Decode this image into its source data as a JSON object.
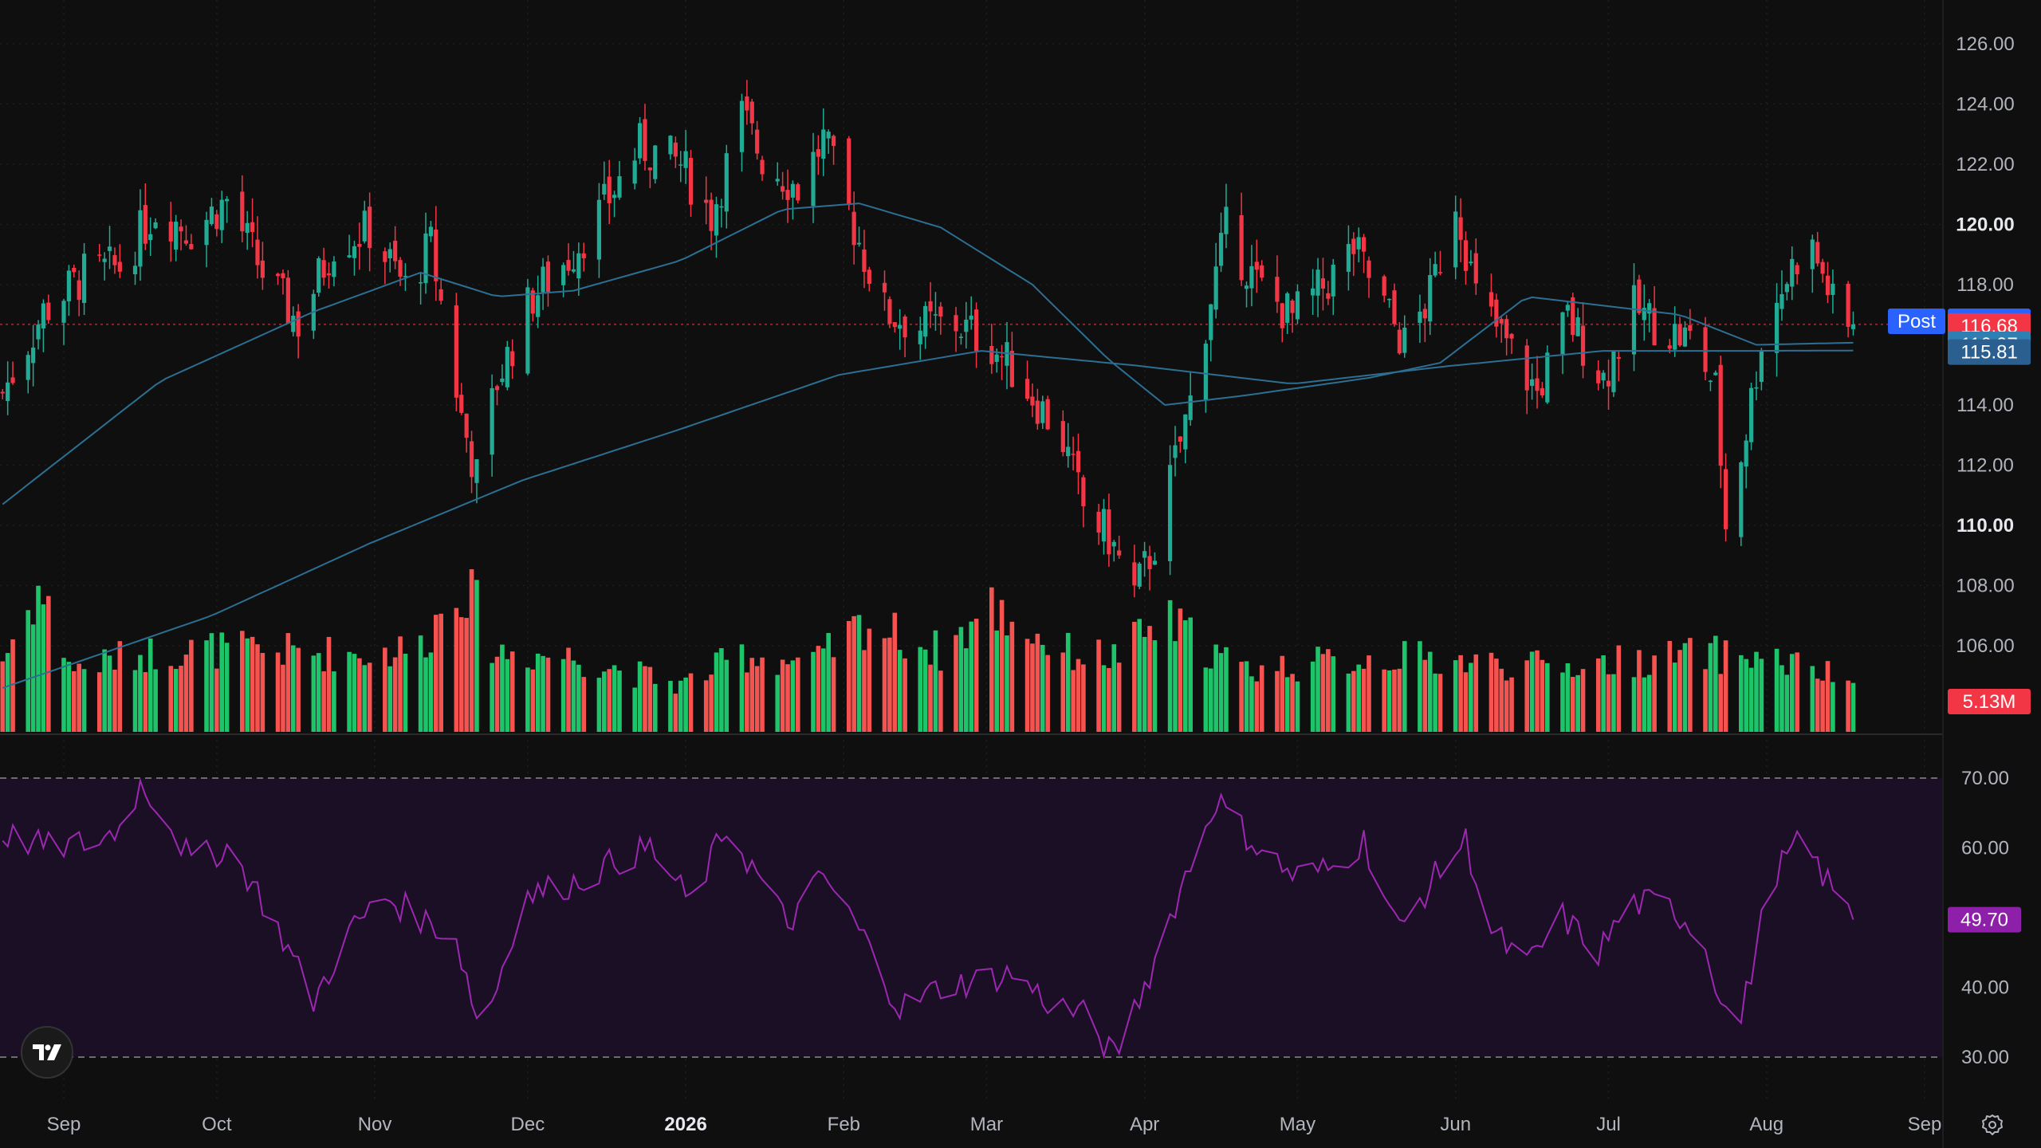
{
  "chart_data": [
    {
      "type": "candlestick",
      "price_axis": {
        "ticks": [
          "126.00",
          "124.00",
          "122.00",
          "120.00",
          "118.00",
          "114.00",
          "112.00",
          "110.00",
          "108.00",
          "106.00"
        ],
        "bold_ticks": [
          "120.00",
          "110.00"
        ],
        "range": [
          104.5,
          126.5
        ]
      },
      "time_axis": {
        "ticks": [
          {
            "label": "Sep",
            "date": "2025-09-01"
          },
          {
            "label": "Oct",
            "date": "2025-10-01"
          },
          {
            "label": "Nov",
            "date": "2025-11-01"
          },
          {
            "label": "Dec",
            "date": "2025-12-01"
          },
          {
            "label": "2026",
            "date": "2026-01-01",
            "bold": true
          },
          {
            "label": "Feb",
            "date": "2026-02-01"
          },
          {
            "label": "Mar",
            "date": "2026-03-01"
          },
          {
            "label": "Apr",
            "date": "2026-04-01"
          },
          {
            "label": "May",
            "date": "2026-05-01"
          },
          {
            "label": "Jun",
            "date": "2026-06-01"
          },
          {
            "label": "Jul",
            "date": "2026-07-01"
          },
          {
            "label": "Aug",
            "date": "2026-08-01"
          },
          {
            "label": "Sep",
            "date": "2026-09-01"
          }
        ]
      },
      "price_path": [
        [
          "2025-08-20",
          114.4
        ],
        [
          "2025-08-28",
          117.1
        ],
        [
          "2025-09-05",
          118.3
        ],
        [
          "2025-09-12",
          118.6
        ],
        [
          "2025-09-19",
          120.5
        ],
        [
          "2025-09-26",
          119.8
        ],
        [
          "2025-10-03",
          120.8
        ],
        [
          "2025-10-10",
          118.4
        ],
        [
          "2025-10-17",
          116.7
        ],
        [
          "2025-10-24",
          119.4
        ],
        [
          "2025-10-31",
          119.8
        ],
        [
          "2025-11-07",
          117.9
        ],
        [
          "2025-11-12",
          119.3
        ],
        [
          "2025-11-18",
          113.6
        ],
        [
          "2025-11-21",
          111.6
        ],
        [
          "2025-11-25",
          114.8
        ],
        [
          "2025-12-02",
          117.6
        ],
        [
          "2025-12-09",
          118.9
        ],
        [
          "2025-12-16",
          120.6
        ],
        [
          "2025-12-23",
          122.6
        ],
        [
          "2025-12-31",
          122.0
        ],
        [
          "2026-01-06",
          120.3
        ],
        [
          "2026-01-12",
          123.6
        ],
        [
          "2026-01-16",
          122.2
        ],
        [
          "2026-01-23",
          121.2
        ],
        [
          "2026-01-28",
          122.8
        ],
        [
          "2026-02-03",
          119.9
        ],
        [
          "2026-02-09",
          117.1
        ],
        [
          "2026-02-16",
          116.6
        ],
        [
          "2026-02-23",
          116.7
        ],
        [
          "2026-03-02",
          116.0
        ],
        [
          "2026-03-06",
          115.2
        ],
        [
          "2026-03-11",
          114.1
        ],
        [
          "2026-03-16",
          112.8
        ],
        [
          "2026-03-20",
          110.6
        ],
        [
          "2026-03-25",
          109.6
        ],
        [
          "2026-03-30",
          107.7
        ],
        [
          "2026-04-03",
          109.4
        ],
        [
          "2026-04-07",
          112.1
        ],
        [
          "2026-04-10",
          114.1
        ],
        [
          "2026-04-14",
          117.6
        ],
        [
          "2026-04-17",
          119.8
        ],
        [
          "2026-04-23",
          118.0
        ],
        [
          "2026-04-30",
          116.9
        ],
        [
          "2026-05-07",
          118.1
        ],
        [
          "2026-05-12",
          119.2
        ],
        [
          "2026-05-18",
          117.3
        ],
        [
          "2026-05-22",
          116.0
        ],
        [
          "2026-05-27",
          117.6
        ],
        [
          "2026-06-01",
          120.9
        ],
        [
          "2026-06-05",
          117.6
        ],
        [
          "2026-06-11",
          116.0
        ],
        [
          "2026-06-17",
          114.4
        ],
        [
          "2026-06-23",
          116.9
        ],
        [
          "2026-06-30",
          114.9
        ],
        [
          "2026-07-06",
          117.2
        ],
        [
          "2026-07-12",
          116.5
        ],
        [
          "2026-07-18",
          116.1
        ],
        [
          "2026-07-22",
          114.5
        ],
        [
          "2026-07-24",
          110.0
        ],
        [
          "2026-07-28",
          113.2
        ],
        [
          "2026-07-31",
          116.2
        ],
        [
          "2026-08-04",
          117.9
        ],
        [
          "2026-08-09",
          119.6
        ],
        [
          "2026-08-13",
          117.9
        ],
        [
          "2026-08-16",
          116.2
        ],
        [
          "2026-08-18",
          116.68
        ]
      ],
      "ma_short": [
        [
          "2025-08-20",
          110.7
        ],
        [
          "2025-09-20",
          114.8
        ],
        [
          "2025-10-20",
          117.1
        ],
        [
          "2025-11-10",
          118.4
        ],
        [
          "2025-11-25",
          117.6
        ],
        [
          "2025-12-10",
          117.8
        ],
        [
          "2025-12-31",
          118.8
        ],
        [
          "2026-01-20",
          120.5
        ],
        [
          "2026-02-04",
          120.7
        ],
        [
          "2026-02-20",
          119.9
        ],
        [
          "2026-03-10",
          118.0
        ],
        [
          "2026-03-25",
          115.5
        ],
        [
          "2026-04-05",
          114.0
        ],
        [
          "2026-04-20",
          114.3
        ],
        [
          "2026-05-15",
          114.9
        ],
        [
          "2026-05-29",
          115.4
        ],
        [
          "2026-06-15",
          117.6
        ],
        [
          "2026-06-30",
          117.3
        ],
        [
          "2026-07-15",
          117.0
        ],
        [
          "2026-07-30",
          116.0
        ],
        [
          "2026-08-18",
          116.07
        ]
      ],
      "ma_long": [
        [
          "2025-08-20",
          104.6
        ],
        [
          "2025-09-30",
          107.0
        ],
        [
          "2025-10-31",
          109.4
        ],
        [
          "2025-11-30",
          111.5
        ],
        [
          "2025-12-31",
          113.2
        ],
        [
          "2026-01-31",
          115.0
        ],
        [
          "2026-02-28",
          115.8
        ],
        [
          "2026-03-31",
          115.3
        ],
        [
          "2026-04-30",
          114.7
        ],
        [
          "2026-05-31",
          115.3
        ],
        [
          "2026-06-30",
          115.8
        ],
        [
          "2026-07-31",
          115.8
        ],
        [
          "2026-08-18",
          115.81
        ]
      ],
      "volume_path": [
        [
          "2025-08-20",
          2.8
        ],
        [
          "2025-08-27",
          5.5
        ],
        [
          "2025-09-03",
          2.4
        ],
        [
          "2025-09-15",
          3.0
        ],
        [
          "2025-09-30",
          3.2
        ],
        [
          "2025-10-15",
          3.1
        ],
        [
          "2025-11-01",
          3.0
        ],
        [
          "2025-11-10",
          3.3
        ],
        [
          "2025-11-18",
          5.9
        ],
        [
          "2025-11-25",
          3.1
        ],
        [
          "2025-12-10",
          2.9
        ],
        [
          "2025-12-31",
          1.8
        ],
        [
          "2026-01-12",
          3.0
        ],
        [
          "2026-01-26",
          2.6
        ],
        [
          "2026-02-05",
          4.2
        ],
        [
          "2026-02-20",
          3.1
        ],
        [
          "2026-03-02",
          4.8
        ],
        [
          "2026-03-16",
          3.1
        ],
        [
          "2026-03-26",
          2.9
        ],
        [
          "2026-04-05",
          4.3
        ],
        [
          "2026-04-20",
          2.4
        ],
        [
          "2026-05-20",
          2.9
        ],
        [
          "2026-06-20",
          2.5
        ],
        [
          "2026-07-20",
          3.0
        ],
        [
          "2026-08-01",
          2.9
        ],
        [
          "2026-08-18",
          1.9
        ]
      ],
      "series": [
        {
          "name": "Post",
          "value": "116.78",
          "color": "#2962ff"
        },
        {
          "name": "",
          "value": "116.68",
          "color": "#f23645"
        },
        {
          "name": "",
          "value": "116.07",
          "color": "#2f7fb3"
        },
        {
          "name": "",
          "value": "115.81",
          "color": "#2a5f8f"
        }
      ],
      "volume_label": "5.13M",
      "colors": {
        "up": "#22ab94",
        "down": "#f23645",
        "vol_up": "#1ec46a",
        "vol_down": "#f5534f",
        "ma": "#2c6f93",
        "grid": "#1f1f1f",
        "current_line": "#f23645"
      }
    },
    {
      "type": "line",
      "indicator": "RSI",
      "y_ticks": [
        "70.00",
        "60.00",
        "50.00",
        "40.00",
        "30.00"
      ],
      "ylim": [
        27.5,
        71.5
      ],
      "bands": [
        30,
        70
      ],
      "current_value": "49.70",
      "path": [
        [
          "2025-08-20",
          62
        ],
        [
          "2025-08-29",
          60
        ],
        [
          "2025-09-08",
          61
        ],
        [
          "2025-09-12",
          63
        ],
        [
          "2025-09-16",
          69
        ],
        [
          "2025-09-20",
          66
        ],
        [
          "2025-09-26",
          58
        ],
        [
          "2025-10-03",
          60
        ],
        [
          "2025-10-08",
          55
        ],
        [
          "2025-10-14",
          47
        ],
        [
          "2025-10-20",
          38
        ],
        [
          "2025-10-27",
          48
        ],
        [
          "2025-11-03",
          53
        ],
        [
          "2025-11-10",
          50
        ],
        [
          "2025-11-17",
          47
        ],
        [
          "2025-11-22",
          33
        ],
        [
          "2025-11-30",
          53
        ],
        [
          "2025-12-10",
          55
        ],
        [
          "2025-12-18",
          58
        ],
        [
          "2025-12-25",
          60
        ],
        [
          "2026-01-02",
          52
        ],
        [
          "2026-01-09",
          63
        ],
        [
          "2026-01-16",
          55
        ],
        [
          "2026-01-21",
          49
        ],
        [
          "2026-01-28",
          56
        ],
        [
          "2026-02-05",
          47
        ],
        [
          "2026-02-12",
          37
        ],
        [
          "2026-02-20",
          40
        ],
        [
          "2026-02-27",
          41
        ],
        [
          "2026-03-06",
          42
        ],
        [
          "2026-03-13",
          38
        ],
        [
          "2026-03-20",
          36
        ],
        [
          "2026-03-26",
          30
        ],
        [
          "2026-04-02",
          42
        ],
        [
          "2026-04-08",
          54
        ],
        [
          "2026-04-15",
          67
        ],
        [
          "2026-04-22",
          61
        ],
        [
          "2026-04-30",
          56
        ],
        [
          "2026-05-08",
          57
        ],
        [
          "2026-05-14",
          61
        ],
        [
          "2026-05-21",
          48
        ],
        [
          "2026-05-29",
          57
        ],
        [
          "2026-06-03",
          61
        ],
        [
          "2026-06-08",
          48
        ],
        [
          "2026-06-15",
          43
        ],
        [
          "2026-06-22",
          50
        ],
        [
          "2026-06-29",
          45
        ],
        [
          "2026-07-05",
          52
        ],
        [
          "2026-07-12",
          52
        ],
        [
          "2026-07-19",
          48
        ],
        [
          "2026-07-26",
          32
        ],
        [
          "2026-08-02",
          56
        ],
        [
          "2026-08-08",
          61
        ],
        [
          "2026-08-13",
          55
        ],
        [
          "2026-08-18",
          49.7
        ]
      ],
      "colors": {
        "line": "#9c27b0",
        "band_fill": "#1b0f26",
        "badge": "#8e1fa8"
      }
    }
  ]
}
